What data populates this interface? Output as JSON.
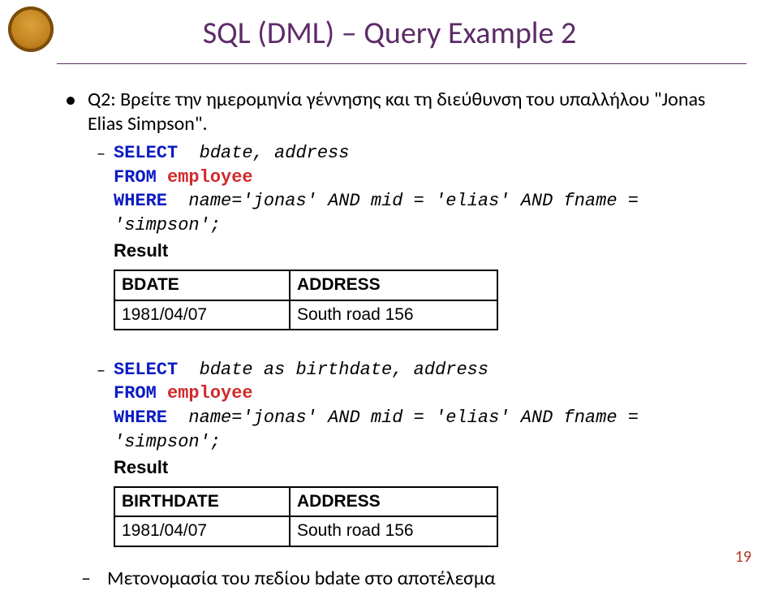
{
  "title": "SQL (DML) – Query Example 2",
  "question": "Q2: Βρείτε την ημερομηνία γέννησης και τη διεύθυνση του υπαλλήλου \"Jonas Elias Simpson\".",
  "result_label": "Result",
  "q1": {
    "select": "SELECT",
    "cols": "bdate, address",
    "from": "FROM",
    "table": "employee",
    "where": "WHERE",
    "c1": "name='jonas'",
    "and1": "AND",
    "c2": "mid = 'elias'",
    "and2": "AND",
    "c3": "fname = 'simpson';"
  },
  "r1": {
    "h0": "BDATE",
    "h1": "ADDRESS",
    "v0": "1981/04/07",
    "v1": "South road 156"
  },
  "q2": {
    "select": "SELECT",
    "cols": "bdate as birthdate, address",
    "from": "FROM",
    "table": "employee",
    "where": "WHERE",
    "c1": "name='jonas'",
    "and1": "AND",
    "c2": "mid = 'elias'",
    "and2": "AND",
    "c3": "fname = 'simpson';"
  },
  "r2": {
    "h0": "BIRTHDATE",
    "h1": "ADDRESS",
    "v0": "1981/04/07",
    "v1": "South road 156"
  },
  "note": "Μετονομασία του πεδίου bdate στο αποτέλεσμα",
  "page": "19"
}
